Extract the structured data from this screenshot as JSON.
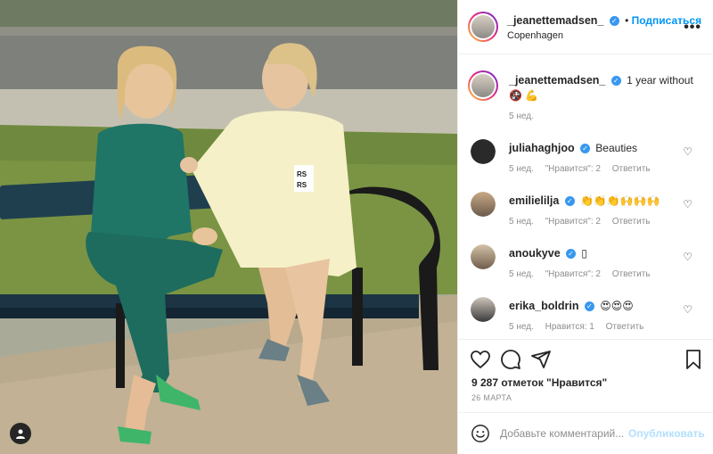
{
  "post": {
    "author": "_jeanettemadsen_",
    "follow_label": "Подписаться",
    "location": "Copenhagen",
    "more_label": "•••",
    "caption_text": "1 year without",
    "caption_emoji": "🚱 💪",
    "caption_time": "5 нед."
  },
  "comments": [
    {
      "user": "juliahaghjoo",
      "text": "Beauties",
      "time": "5 нед.",
      "likes": "\"Нравится\": 2",
      "reply": "Ответить"
    },
    {
      "user": "emilielilja",
      "text": "👏👏👏🙌🙌🙌",
      "time": "5 нед.",
      "likes": "\"Нравится\": 2",
      "reply": "Ответить"
    },
    {
      "user": "anoukyve",
      "text": "▯",
      "time": "5 нед.",
      "likes": "\"Нравится\": 2",
      "reply": "Ответить"
    },
    {
      "user": "erika_boldrin",
      "text": "😍😍😍",
      "time": "5 нед.",
      "likes": "Нравится: 1",
      "reply": "Ответить"
    }
  ],
  "likes_text": "9 287 отметок \"Нравится\"",
  "date_text": "26 МАРТА",
  "add_comment": {
    "placeholder": "Добавьте комментарий...",
    "post_label": "Опубликовать"
  },
  "icons": [
    "heart-icon",
    "comment-icon",
    "share-icon",
    "bookmark-icon",
    "emoji-icon",
    "user-icon"
  ],
  "colors": {
    "accent": "#0095f6",
    "verified": "#3897f0",
    "muted": "#8e8e8e",
    "post_disabled": "#b2dffc"
  }
}
